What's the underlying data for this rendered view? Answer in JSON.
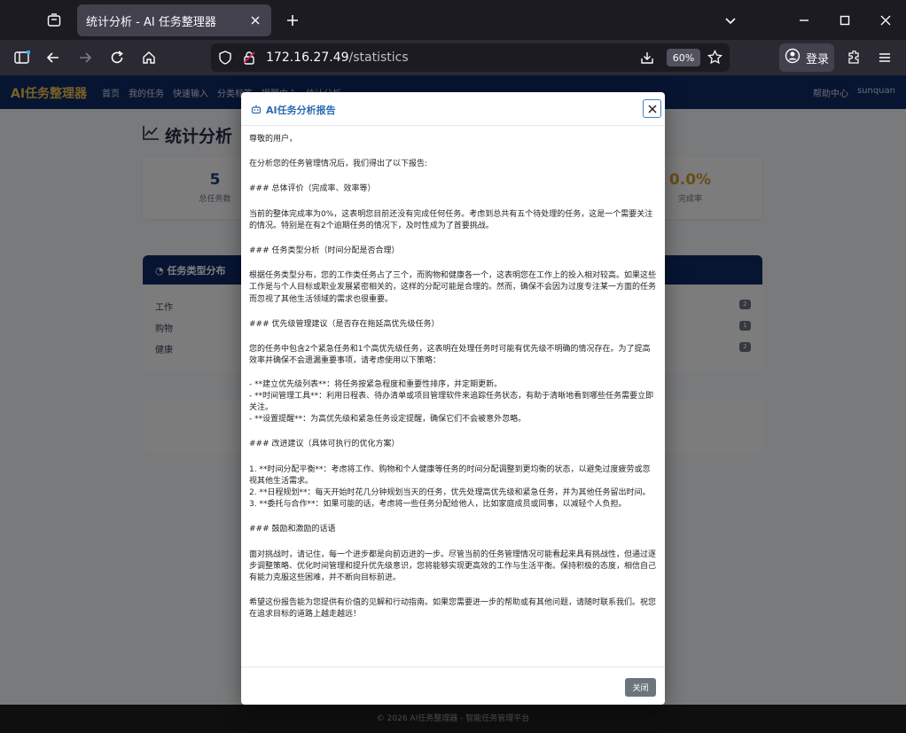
{
  "browser": {
    "tab_title": "统计分析 - AI 任务整理器",
    "url_host": "172.16.27.49",
    "url_path": "/statistics",
    "zoom": "60%",
    "login_label": "登录"
  },
  "app": {
    "brand": "AI任务整理器",
    "nav": [
      "首页",
      "我的任务",
      "快速输入",
      "分类标签",
      "提醒中心",
      "统计分析"
    ],
    "help": "帮助中心",
    "user": "sunquan"
  },
  "page": {
    "title": "统计分析",
    "stats": [
      {
        "value": "5",
        "label": "总任务数"
      },
      {
        "value": "0.0%",
        "label": "完成率"
      }
    ],
    "type_card_title": "任务类型分布",
    "types": [
      {
        "name": "工作",
        "count": "2"
      },
      {
        "name": "购物",
        "count": "1"
      },
      {
        "name": "健康",
        "count": "2"
      }
    ],
    "footer": "© 2026 AI任务整理器 - 智能任务管理平台"
  },
  "modal": {
    "title": "AI任务分析报告",
    "close_label": "关闭",
    "paragraphs": [
      "尊敬的用户，",
      "在分析您的任务管理情况后，我们得出了以下报告:",
      "### 总体评价（完成率、效率等）",
      "当前的整体完成率为0%，这表明您目前还没有完成任何任务。考虑到总共有五个待处理的任务，这是一个需要关注的情况。特别是在有2个逾期任务的情况下，及时性成为了首要挑战。",
      "### 任务类型分析（时间分配是否合理）",
      "根据任务类型分布，您的工作类任务占了三个，而购物和健康各一个，这表明您在工作上的投入相对较高。如果这些工作是与个人目标或职业发展紧密相关的，这样的分配可能是合理的。然而，确保不会因为过度专注某一方面的任务而忽视了其他生活领域的需求也很重要。",
      "### 优先级管理建议（是否存在拖延高优先级任务）",
      "您的任务中包含2个紧急任务和1个高优先级任务，这表明在处理任务时可能有优先级不明确的情况存在。为了提高效率并确保不会遗漏重要事项，请考虑使用以下策略：\n\n- **建立优先级列表**：将任务按紧急程度和重要性排序，并定期更新。\n- **时间管理工具**：利用日程表、待办清单或项目管理软件来追踪任务状态，有助于清晰地看到哪些任务需要立即关注。\n- **设置提醒**：为高优先级和紧急任务设定提醒，确保它们不会被意外忽略。",
      "### 改进建议（具体可执行的优化方案）",
      "1. **时间分配平衡**：考虑将工作、购物和个人健康等任务的时间分配调整到更均衡的状态，以避免过度疲劳或忽视其他生活需求。\n2. **日程规划**：每天开始时花几分钟规划当天的任务，优先处理高优先级和紧急任务，并为其他任务留出时间。\n3. **委托与合作**：如果可能的话，考虑将一些任务分配给他人，比如家庭成员或同事，以减轻个人负担。",
      "### 鼓励和激励的话语",
      "面对挑战时，请记住，每一个进步都是向前迈进的一步。尽管当前的任务管理情况可能看起来具有挑战性，但通过逐步调整策略、优化时间管理和提升优先级意识，您将能够实现更高效的工作与生活平衡。保持积极的态度，相信自己有能力克服这些困难，并不断向目标前进。",
      "希望这份报告能为您提供有价值的见解和行动指南。如果您需要进一步的帮助或有其他问题，请随时联系我们。祝您在追求目标的道路上越走越远！"
    ]
  }
}
